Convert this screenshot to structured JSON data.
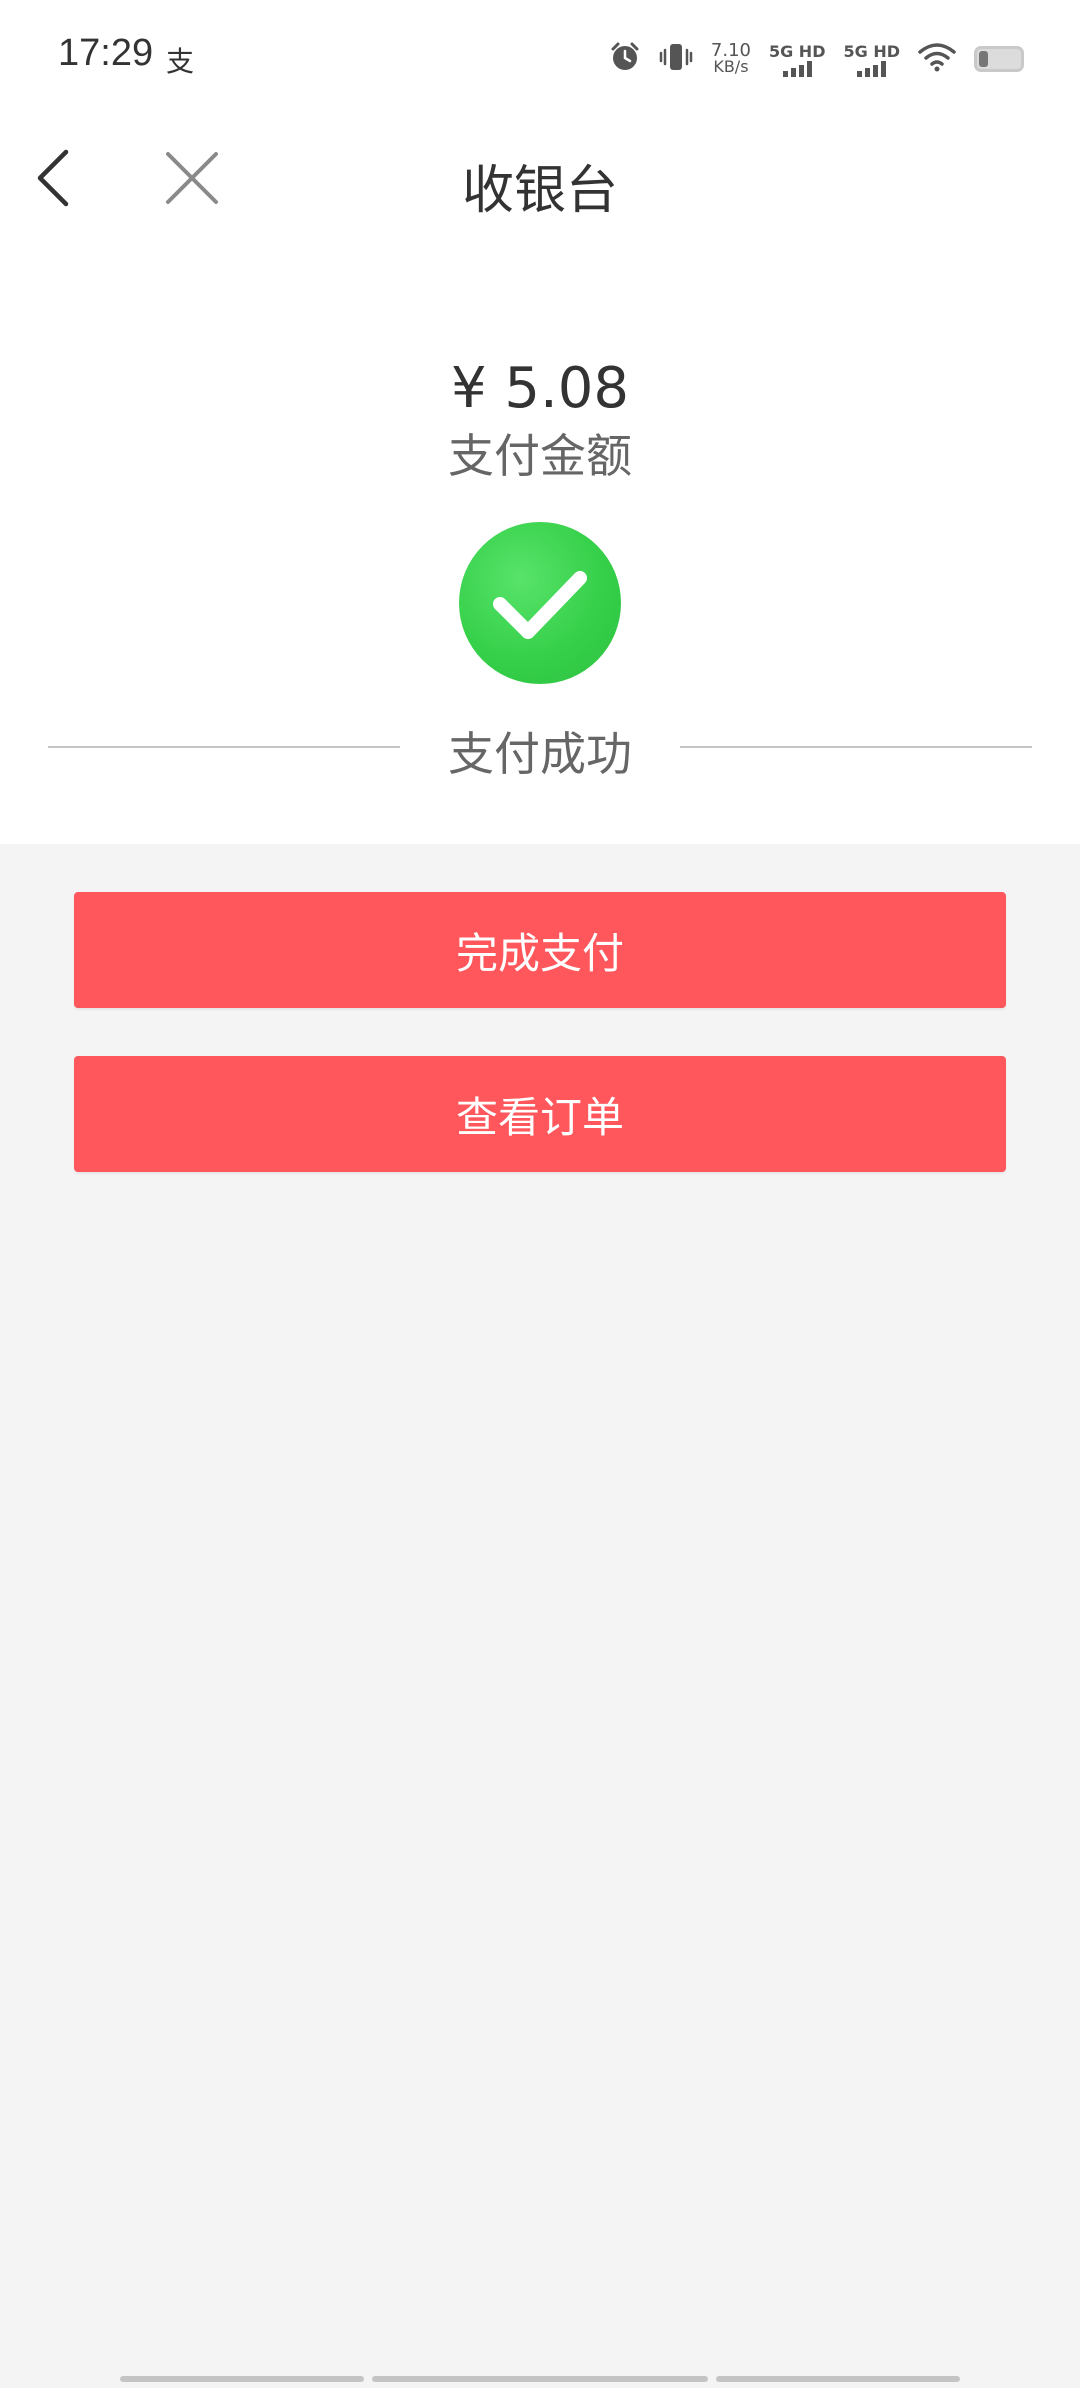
{
  "status_bar": {
    "time": "17:29",
    "alipay_glyph": "支",
    "speed_value": "7.10",
    "speed_unit": "KB/s",
    "sim1": "5G HD",
    "sim2": "5G HD",
    "icons": [
      "alarm-icon",
      "vibrate-icon",
      "signal-icon",
      "signal-icon",
      "wifi-icon",
      "battery-icon"
    ]
  },
  "nav": {
    "title": "收银台",
    "back_icon": "chevron-left-icon",
    "close_icon": "close-icon"
  },
  "payment": {
    "amount": "¥ 5.08",
    "amount_label": "支付金额",
    "status_text": "支付成功",
    "status_icon": "check-circle-icon"
  },
  "actions": {
    "finish_label": "完成支付",
    "view_order_label": "查看订单"
  },
  "colors": {
    "primary_button": "#ff575c",
    "success_green": "#36d04a",
    "page_bg": "#f4f4f4"
  }
}
